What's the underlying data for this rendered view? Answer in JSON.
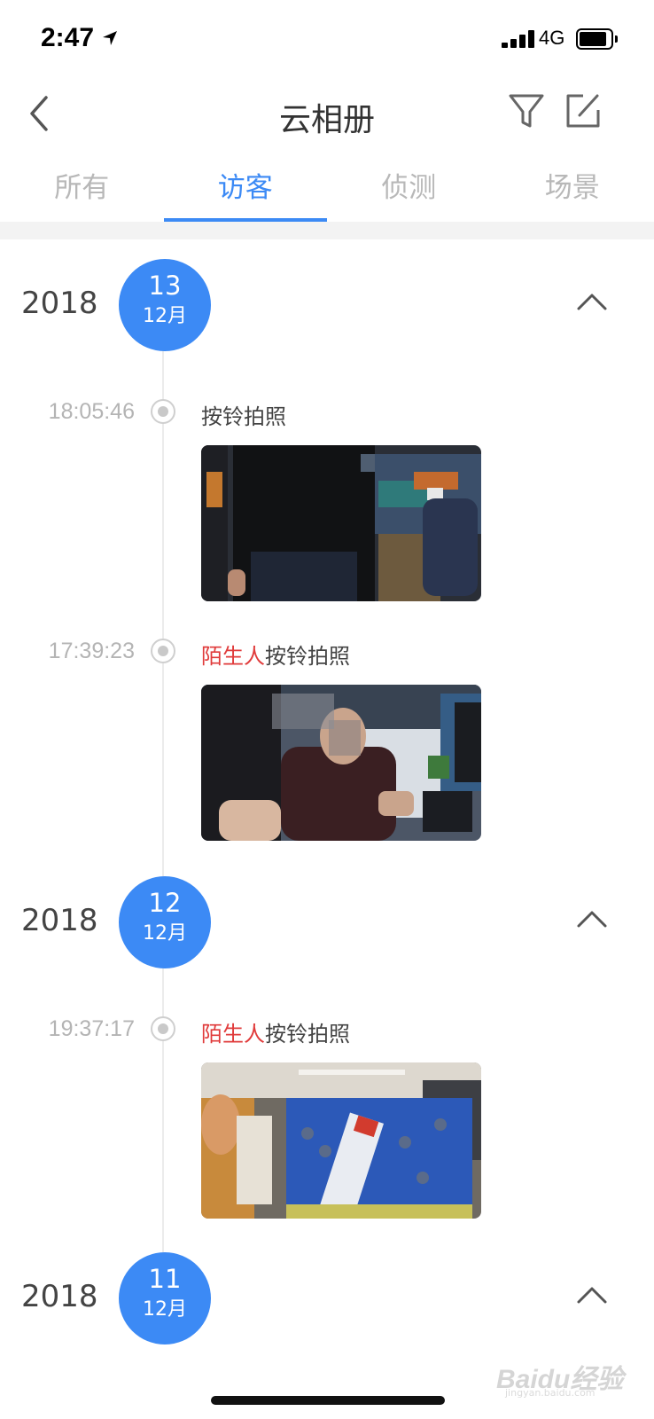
{
  "status_bar": {
    "time": "2:47",
    "network": "4G"
  },
  "nav": {
    "title": "云相册"
  },
  "tabs": [
    {
      "label": "所有",
      "active": false
    },
    {
      "label": "访客",
      "active": true
    },
    {
      "label": "侦测",
      "active": false
    },
    {
      "label": "场景",
      "active": false
    }
  ],
  "groups": [
    {
      "year": "2018",
      "day": "13",
      "month": "12月",
      "events": [
        {
          "time": "18:05:46",
          "tag": "",
          "label": "按铃拍照"
        },
        {
          "time": "17:39:23",
          "tag": "陌生人",
          "label": "按铃拍照"
        }
      ]
    },
    {
      "year": "2018",
      "day": "12",
      "month": "12月",
      "events": [
        {
          "time": "19:37:17",
          "tag": "陌生人",
          "label": "按铃拍照"
        }
      ]
    },
    {
      "year": "2018",
      "day": "11",
      "month": "12月",
      "events": []
    }
  ],
  "watermark": {
    "brand": "Baidu经验",
    "url": "jingyan.baidu.com"
  },
  "colors": {
    "accent": "#3c8af5",
    "stranger": "#e03b3b"
  }
}
